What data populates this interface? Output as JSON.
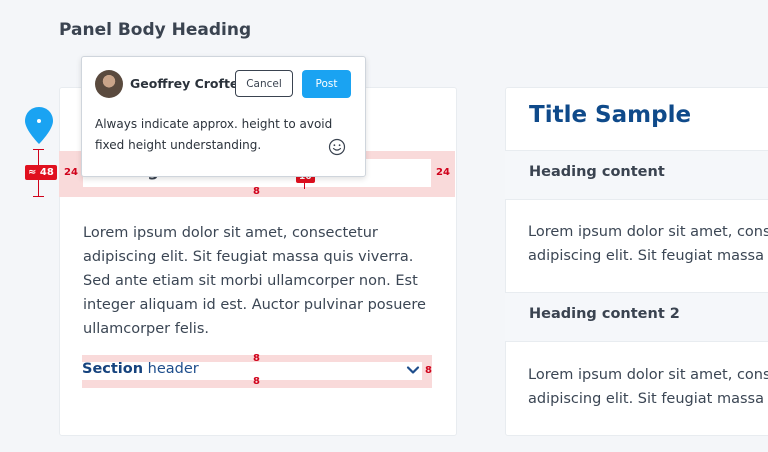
{
  "panel": {
    "heading": "Panel Body Heading"
  },
  "left_card": {
    "heading": "Heading content",
    "body": "Lorem ipsum dolor sit amet, consectetur adipiscing elit. Sit feugiat massa quis viverra. Sed ante etiam sit morbi ullamcorper non. Est integer aliquam id est. Auctor pulvinar posuere ullamcorper felis.",
    "section_bold": "Section",
    "section_rest": " header",
    "spacing": {
      "left": "24",
      "right": "24",
      "bottom": "8",
      "inline_badge": "16",
      "section_top": "8",
      "section_bottom": "8",
      "section_right": "8"
    }
  },
  "measure": {
    "height_label": "≈ 48"
  },
  "comment": {
    "user": "Geoffrey Crofte",
    "cancel_label": "Cancel",
    "post_label": "Post",
    "text": "Always indicate approx. height to avoid fixed height understanding."
  },
  "right_card": {
    "title": "Title Sample",
    "heading_1": "Heading content",
    "body_1_line1": "Lorem ipsum dolor sit amet, conse",
    "body_1_line2": "adipiscing elit. Sit feugiat massa qu",
    "heading_2": "Heading content 2",
    "body_2_line1": "Lorem ipsum dolor sit amet, conse",
    "body_2_line2": "adipiscing elit. Sit feugiat massa qu"
  },
  "colors": {
    "accent": "#1aa3f2",
    "title": "#0f4a8a",
    "spacing_red": "#d0021b",
    "spacing_pink": "#f9dada"
  }
}
